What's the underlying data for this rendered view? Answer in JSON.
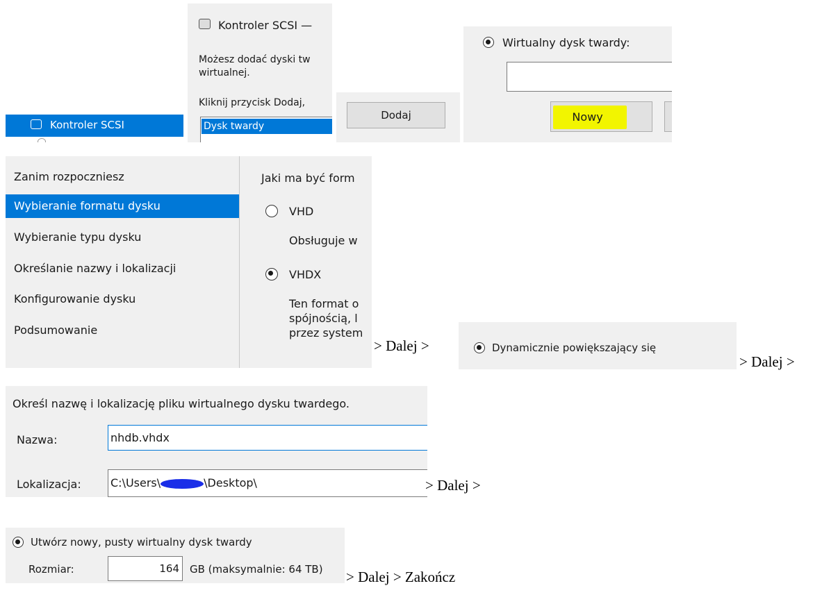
{
  "step1": {
    "sidebar_selected": "Kontroler SCSI",
    "dialog_title": "Kontroler SCSI —",
    "dialog_text_line1": "Możesz dodać dyski tw",
    "dialog_text_line2": "wirtualnej.",
    "dialog_hint": "Kliknij przycisk Dodaj, ",
    "list_item_selected": "Dysk twardy",
    "add_button": "Dodaj",
    "vhd_radio_label": "Wirtualny dysk twardy:",
    "new_button": "Nowy"
  },
  "wizard_nav": {
    "items": [
      "Zanim rozpoczniesz",
      "Wybieranie formatu dysku",
      "Wybieranie typu dysku",
      "Określanie nazwy i lokalizacji",
      "Konfigurowanie dysku",
      "Podsumowanie"
    ],
    "selected_index": 1
  },
  "format_page": {
    "question": "Jaki ma być form",
    "option_vhd": "VHD",
    "option_vhd_desc": "Obsługuje w",
    "option_vhdx": "VHDX",
    "option_vhdx_desc_1": "Ten format o",
    "option_vhdx_desc_2": "spójnością, l",
    "option_vhdx_desc_3": "przez system"
  },
  "connectors": {
    "next_1": "> Dalej >",
    "next_2": "> Dalej >",
    "next_3": "> Dalej >",
    "final": "> Dalej > Zakończ"
  },
  "type_page": {
    "option_dynamic": "Dynamicznie powiększający się"
  },
  "name_page": {
    "heading": "Określ nazwę i lokalizację pliku wirtualnego dysku twardego.",
    "name_label": "Nazwa:",
    "name_value": "nhdb.vhdx",
    "location_label": "Lokalizacja:",
    "location_value_prefix": "C:\\Users\\",
    "location_value_suffix": "\\Desktop\\"
  },
  "config_page": {
    "option_new": "Utwórz nowy, pusty wirtualny dysk twardy",
    "size_label": "Rozmiar:",
    "size_value": "164",
    "size_unit": "GB (maksymalnie: 64 TB)"
  },
  "colors": {
    "selection": "#0078d7",
    "highlight": "#f2f500",
    "redaction": "#1a2ee8"
  }
}
